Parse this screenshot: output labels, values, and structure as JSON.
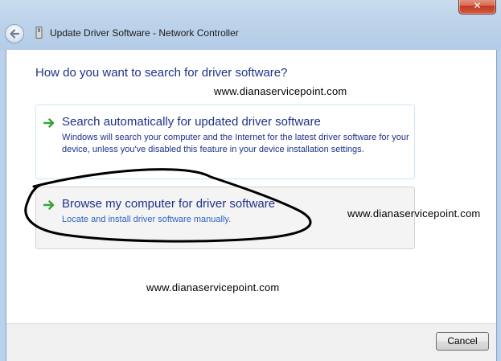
{
  "window": {
    "title": "Update Driver Software - Network Controller",
    "close_glyph": "✕",
    "icons": {
      "back": "back-arrow-icon",
      "title": "network-adapter-icon",
      "close": "close-icon"
    }
  },
  "heading": "How do you want to search for driver software?",
  "watermark": "www.dianaservicepoint.com",
  "options": [
    {
      "title": "Search automatically for updated driver software",
      "description": "Windows will search your computer and the Internet for the latest driver software for your device, unless you've disabled this feature in your device installation settings."
    },
    {
      "title": "Browse my computer for driver software",
      "description": "Locate and install driver software manually."
    }
  ],
  "footer": {
    "cancel_label": "Cancel"
  },
  "colors": {
    "heading_blue": "#1e3287",
    "link_blue": "#2f63c5",
    "arrow_green": "#3aa23a",
    "annotation_ink": "#000000"
  }
}
